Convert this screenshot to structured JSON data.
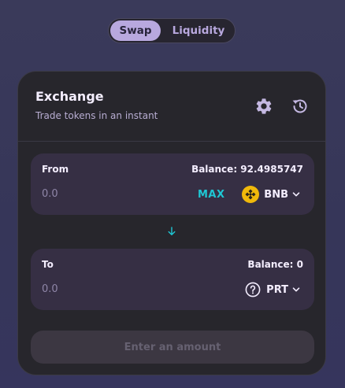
{
  "toggle": {
    "swap_label": "Swap",
    "liquidity_label": "Liquidity",
    "active": "swap"
  },
  "card": {
    "title": "Exchange",
    "subtitle": "Trade tokens in an instant",
    "settings_icon": "gear-icon",
    "history_icon": "history-icon"
  },
  "from": {
    "label": "From",
    "balance": "Balance: 92.4985747",
    "amount_placeholder": "0.0",
    "max_label": "MAX",
    "token": "BNB",
    "token_icon": "bnb-icon"
  },
  "switch_icon": "arrow-down-icon",
  "to": {
    "label": "To",
    "balance": "Balance: 0",
    "amount_placeholder": "0.0",
    "token": "PRT",
    "token_icon": "question-circle-icon"
  },
  "submit": {
    "label": "Enter an amount",
    "disabled": true
  },
  "colors": {
    "accent_cyan": "#1fc7d4",
    "toggle_active": "#b8a8de",
    "text_primary": "#f4eeff",
    "text_secondary": "#b8add2",
    "bnb_yellow": "#f0b90b",
    "panel_bg": "#362f44",
    "card_bg": "#27262c"
  }
}
